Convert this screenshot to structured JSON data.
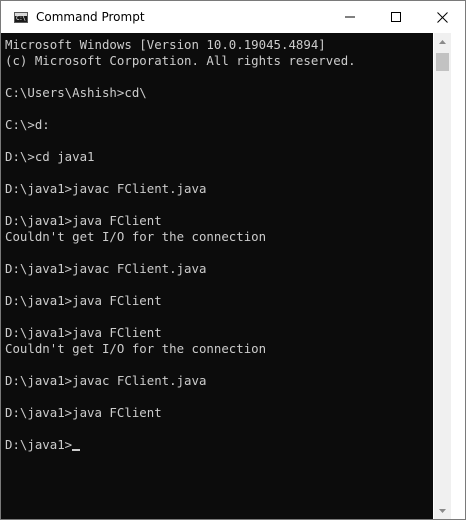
{
  "window": {
    "title": "Command Prompt",
    "app_icon_text": "C:\\",
    "app_icon": "command-prompt-icon",
    "controls": {
      "minimize": "minimize-icon",
      "maximize": "maximize-icon",
      "close": "close-icon"
    }
  },
  "console": {
    "lines": [
      "Microsoft Windows [Version 10.0.19045.4894]",
      "(c) Microsoft Corporation. All rights reserved.",
      "",
      "C:\\Users\\Ashish>cd\\",
      "",
      "C:\\>d:",
      "",
      "D:\\>cd java1",
      "",
      "D:\\java1>javac FClient.java",
      "",
      "D:\\java1>java FClient",
      "Couldn't get I/O for the connection",
      "",
      "D:\\java1>javac FClient.java",
      "",
      "D:\\java1>java FClient",
      "",
      "D:\\java1>java FClient",
      "Couldn't get I/O for the connection",
      "",
      "D:\\java1>javac FClient.java",
      "",
      "D:\\java1>java FClient",
      ""
    ],
    "current_prompt": "D:\\java1>"
  },
  "colors": {
    "console_background": "#0c0c0c",
    "console_text": "#cccccc",
    "titlebar": "#ffffff",
    "scrollbar_track": "#f0f0f0",
    "scrollbar_thumb": "#c2c2c2"
  }
}
